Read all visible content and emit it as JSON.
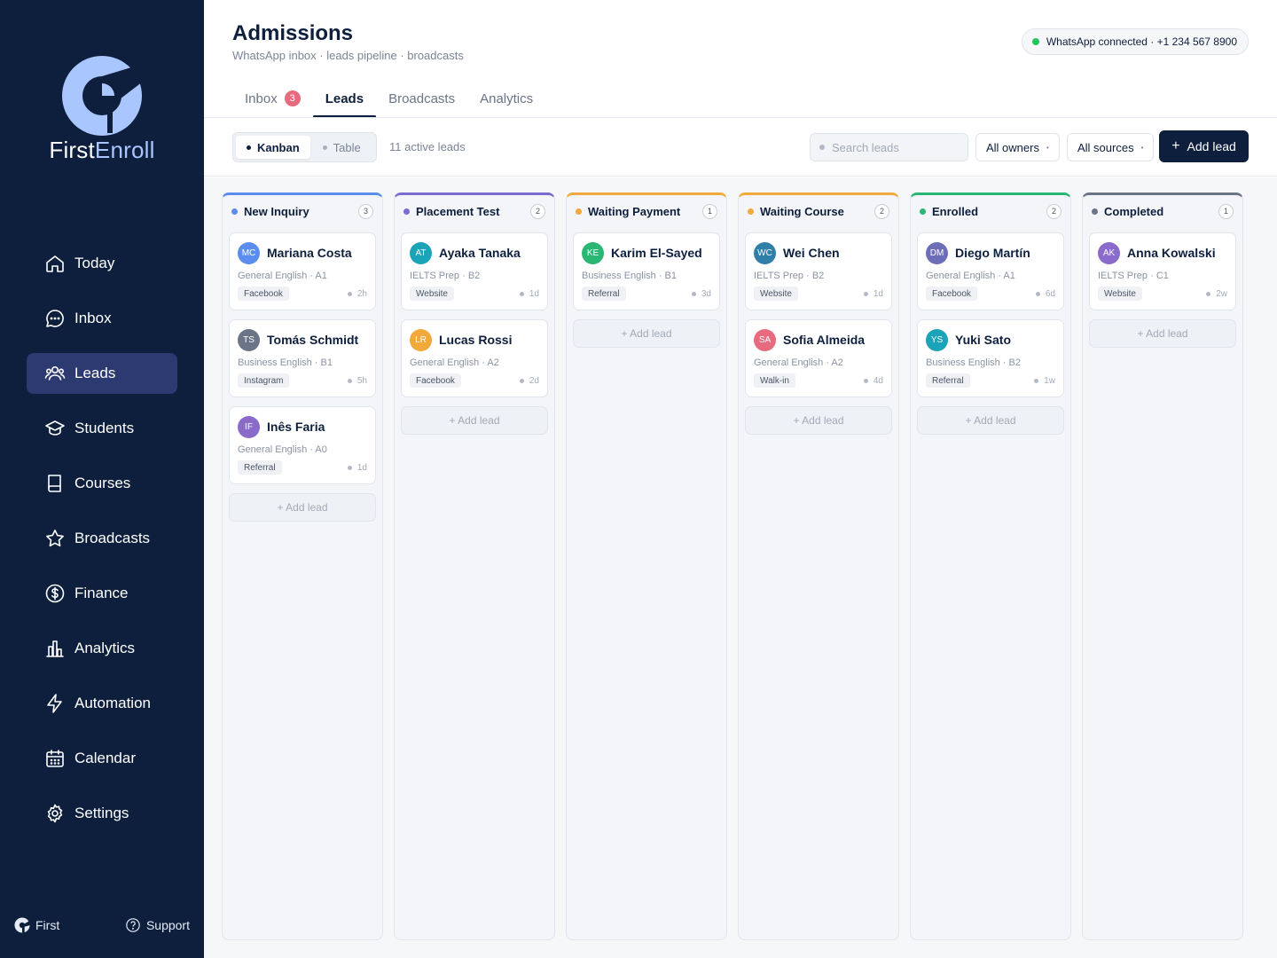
{
  "brand": {
    "name_part1": "First",
    "name_part2": "Enroll",
    "footer_label": "First"
  },
  "sidebar": {
    "items": [
      {
        "label": "Today",
        "icon": "home-icon"
      },
      {
        "label": "Inbox",
        "icon": "chat-icon"
      },
      {
        "label": "Leads",
        "icon": "users-icon",
        "active": true
      },
      {
        "label": "Students",
        "icon": "graduation-cap-icon"
      },
      {
        "label": "Courses",
        "icon": "book-icon"
      },
      {
        "label": "Broadcasts",
        "icon": "star-icon"
      },
      {
        "label": "Finance",
        "icon": "dollar-icon"
      },
      {
        "label": "Analytics",
        "icon": "bar-chart-icon"
      },
      {
        "label": "Automation",
        "icon": "lightning-icon"
      },
      {
        "label": "Calendar",
        "icon": "calendar-icon"
      },
      {
        "label": "Settings",
        "icon": "gear-icon"
      }
    ],
    "support_label": "Support"
  },
  "header": {
    "title": "Admissions",
    "subtitle": "WhatsApp inbox · leads pipeline · broadcasts",
    "whatsapp_status": "WhatsApp connected · +1 234 567 8900"
  },
  "tabs": [
    {
      "label": "Inbox",
      "badge": "3"
    },
    {
      "label": "Leads",
      "active": true
    },
    {
      "label": "Broadcasts"
    },
    {
      "label": "Analytics"
    }
  ],
  "toolbar": {
    "view_kanban": "Kanban",
    "view_table": "Table",
    "lead_count": "11 active leads",
    "search_placeholder": "Search leads",
    "owners_filter": "All owners",
    "sources_filter": "All sources",
    "add_lead": "Add lead"
  },
  "add_lead_card_label": "+ Add lead",
  "colors": {
    "sidebar_bg": "#0d1f3c",
    "active_nav": "#2d3a72",
    "whatsapp_green": "#22c55e",
    "badge_pink": "#e66b7e"
  },
  "columns": [
    {
      "title": "New Inquiry",
      "count": "3",
      "color": "#5b8def",
      "cards": [
        {
          "initials": "MC",
          "name": "Mariana Costa",
          "course": "General English · A1",
          "source": "Facebook",
          "age": "2h",
          "avatar_color": "#5b8def"
        },
        {
          "initials": "TS",
          "name": "Tomás Schmidt",
          "course": "Business English · B1",
          "source": "Instagram",
          "age": "5h",
          "avatar_color": "#6b7587"
        },
        {
          "initials": "IF",
          "name": "Inês Faria",
          "course": "General English · A0",
          "source": "Referral",
          "age": "1d",
          "avatar_color": "#8a6bc9"
        }
      ]
    },
    {
      "title": "Placement Test",
      "count": "2",
      "color": "#7c6bd0",
      "cards": [
        {
          "initials": "AT",
          "name": "Ayaka Tanaka",
          "course": "IELTS Prep · B2",
          "source": "Website",
          "age": "1d",
          "avatar_color": "#1ba3b8"
        },
        {
          "initials": "LR",
          "name": "Lucas Rossi",
          "course": "General English · A2",
          "source": "Facebook",
          "age": "2d",
          "avatar_color": "#f0a93a"
        }
      ]
    },
    {
      "title": "Waiting Payment",
      "count": "1",
      "color": "#f0a93a",
      "cards": [
        {
          "initials": "KE",
          "name": "Karim El-Sayed",
          "course": "Business English · B1",
          "source": "Referral",
          "age": "3d",
          "avatar_color": "#2ab673"
        }
      ]
    },
    {
      "title": "Waiting Course",
      "count": "2",
      "color": "#f0a93a",
      "cards": [
        {
          "initials": "WC",
          "name": "Wei Chen",
          "course": "IELTS Prep · B2",
          "source": "Website",
          "age": "1d",
          "avatar_color": "#2f7fa8"
        },
        {
          "initials": "SA",
          "name": "Sofia Almeida",
          "course": "General English · A2",
          "source": "Walk-in",
          "age": "4d",
          "avatar_color": "#e66b7e"
        }
      ]
    },
    {
      "title": "Enrolled",
      "count": "2",
      "color": "#2ab673",
      "cards": [
        {
          "initials": "DM",
          "name": "Diego Martín",
          "course": "General English · A1",
          "source": "Facebook",
          "age": "6d",
          "avatar_color": "#6c6fb8"
        },
        {
          "initials": "YS",
          "name": "Yuki Sato",
          "course": "Business English · B2",
          "source": "Referral",
          "age": "1w",
          "avatar_color": "#1ba3b8"
        }
      ]
    },
    {
      "title": "Completed",
      "count": "1",
      "color": "#6b7587",
      "cards": [
        {
          "initials": "AK",
          "name": "Anna Kowalski",
          "course": "IELTS Prep · C1",
          "source": "Website",
          "age": "2w",
          "avatar_color": "#8a6bc9"
        }
      ]
    }
  ]
}
